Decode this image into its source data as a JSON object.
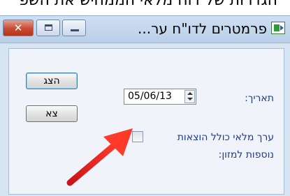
{
  "background_caption": "הגדרות של דוח מלאי הממחיש את השפ",
  "window": {
    "title": "פרמטרים לדו\"ח ער...",
    "close_glyph": "✕",
    "icon": "app-report-icon"
  },
  "buttons": {
    "show_label": "הצג",
    "exit_label": "צא"
  },
  "fields": {
    "date_label": "תאריך:",
    "date_value": "05/06/13",
    "checkbox_label_line1": "ערך מלאי כולל הוצאות",
    "checkbox_label_line2": "נוספות למזון:",
    "checkbox_checked": false
  },
  "annotation": {
    "arrow_color": "#e8201e"
  },
  "colors": {
    "label_text": "#1e3a8c",
    "window_bg": "#d7e4f2",
    "close_button": "#c74a32"
  }
}
